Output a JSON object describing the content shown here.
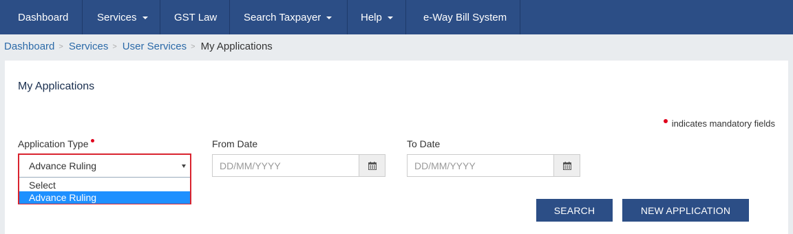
{
  "nav": {
    "items": [
      {
        "label": "Dashboard",
        "dropdown": false
      },
      {
        "label": "Services",
        "dropdown": true
      },
      {
        "label": "GST Law",
        "dropdown": false
      },
      {
        "label": "Search Taxpayer",
        "dropdown": true
      },
      {
        "label": "Help",
        "dropdown": true
      },
      {
        "label": "e-Way Bill System",
        "dropdown": false
      }
    ]
  },
  "breadcrumb": {
    "items": [
      "Dashboard",
      "Services",
      "User Services"
    ],
    "current": "My Applications"
  },
  "page": {
    "title": "My Applications",
    "mandatory_note": "indicates mandatory fields"
  },
  "form": {
    "application_type": {
      "label": "Application Type",
      "selected": "Advance Ruling",
      "options": [
        "Select",
        "Advance Ruling"
      ],
      "highlighted_option": "Advance Ruling"
    },
    "from_date": {
      "label": "From Date",
      "placeholder": "DD/MM/YYYY"
    },
    "to_date": {
      "label": "To Date",
      "placeholder": "DD/MM/YYYY"
    }
  },
  "buttons": {
    "search": "SEARCH",
    "new_application": "NEW APPLICATION"
  },
  "colors": {
    "nav_bg": "#2c4e86",
    "mandatory_red": "#e0001b",
    "highlight_border": "#d9232e",
    "option_selected": "#1e90ff"
  },
  "icons": {
    "calendar": "calendar-icon",
    "dropdown": "caret-down-icon",
    "mandatory": "required-dot-icon"
  }
}
